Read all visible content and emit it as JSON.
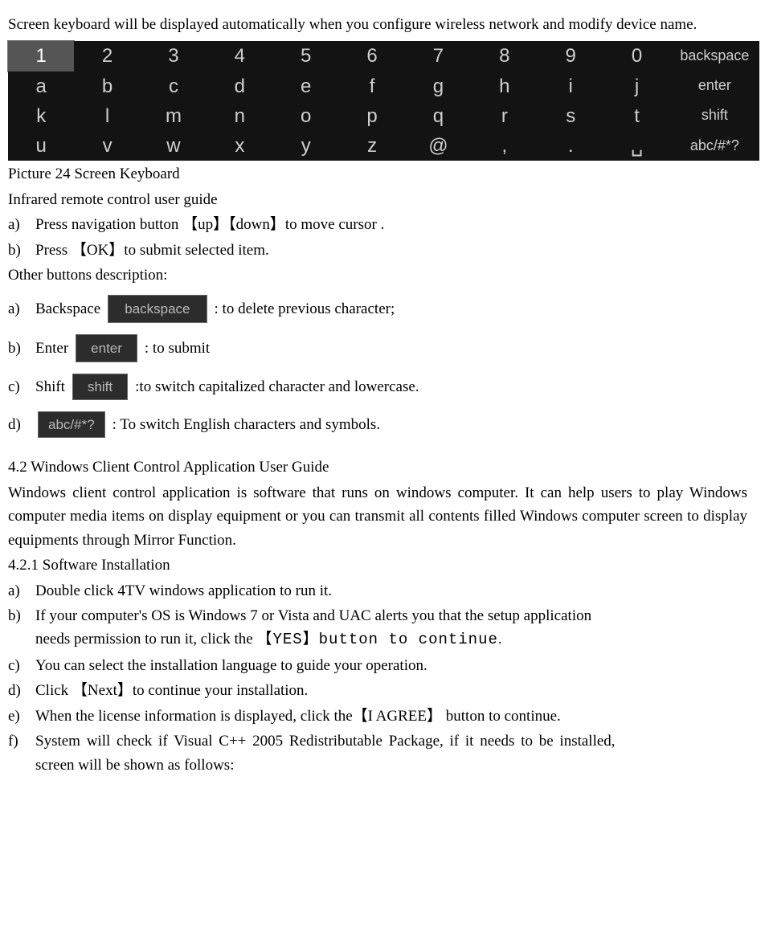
{
  "intro": "Screen keyboard will be displayed automatically when you configure wireless network and modify device name.",
  "keyboard": {
    "row1": {
      "keys": [
        "1",
        "2",
        "3",
        "4",
        "5",
        "6",
        "7",
        "8",
        "9",
        "0"
      ],
      "wide": "backspace",
      "selectedIndex": 0
    },
    "row2": {
      "keys": [
        "a",
        "b",
        "c",
        "d",
        "e",
        "f",
        "g",
        "h",
        "i",
        "j"
      ],
      "wide": "enter"
    },
    "row3": {
      "keys": [
        "k",
        "l",
        "m",
        "n",
        "o",
        "p",
        "q",
        "r",
        "s",
        "t"
      ],
      "wide": "shift"
    },
    "row4": {
      "keys": [
        "u",
        "v",
        "w",
        "x",
        "y",
        "z",
        "@",
        ",",
        ".",
        "␣"
      ],
      "wide": "abc/#*?"
    }
  },
  "caption": "Picture 24 Screen Keyboard",
  "irTitle": "Infrared remote control user guide",
  "irA_marker": "a)",
  "irA_text": "Press navigation button  【up】【down】to move cursor .",
  "irB_marker": "b)",
  "irB_text": "Press 【OK】to submit selected item.",
  "otherTitle": "Other buttons description:",
  "oa_marker": "a)",
  "oa_pre": "Backspace  ",
  "oa_chip": "backspace",
  "oa_post": ": to delete previous character;",
  "ob_marker": "b)",
  "ob_pre": "Enter    ",
  "ob_chip": "enter",
  "ob_post": ": to submit",
  "oc_marker": "c)",
  "oc_pre": "Shift ",
  "oc_chip": "shift",
  "oc_post": " :to switch capitalized character and lowercase.",
  "od_marker": "d)",
  "od_chip": "abc/#*?",
  "od_post": ": To switch English characters and symbols.",
  "secTitle": "4.2   Windows Client Control Application User Guide",
  "secPara": "Windows client control application is software that runs on windows computer. It can help users to play Windows computer media items on display equipment or you can transmit all contents filled Windows computer screen to display equipments through Mirror Function.",
  "subTitle": "4.2.1 Software Installation",
  "sa_marker": "a)",
  "sa": "Double click 4TV windows application to run it.",
  "sb_marker": "b)",
  "sb_line1": "If your computer's OS is Windows 7 or Vista and UAC alerts you that the setup application",
  "sb_line2_pre": "needs permission to run it, click the    ",
  "sb_line2_mono": "【YES】button to continue",
  "sb_line2_post": ".",
  "sc_marker": "c)",
  "sc": "You can select the installation language to guide your operation.",
  "sd_marker": "d)",
  "sd": "Click 【Next】to continue your installation.",
  "se_marker": "e)",
  "se": "When the license information is displayed, click the【I AGREE】  button to continue.",
  "sf_marker": "f)",
  "sf_line1": "System will check if Visual C++ 2005 Redistributable Package, if it needs to be installed,",
  "sf_line2": "screen will be shown as follows:"
}
